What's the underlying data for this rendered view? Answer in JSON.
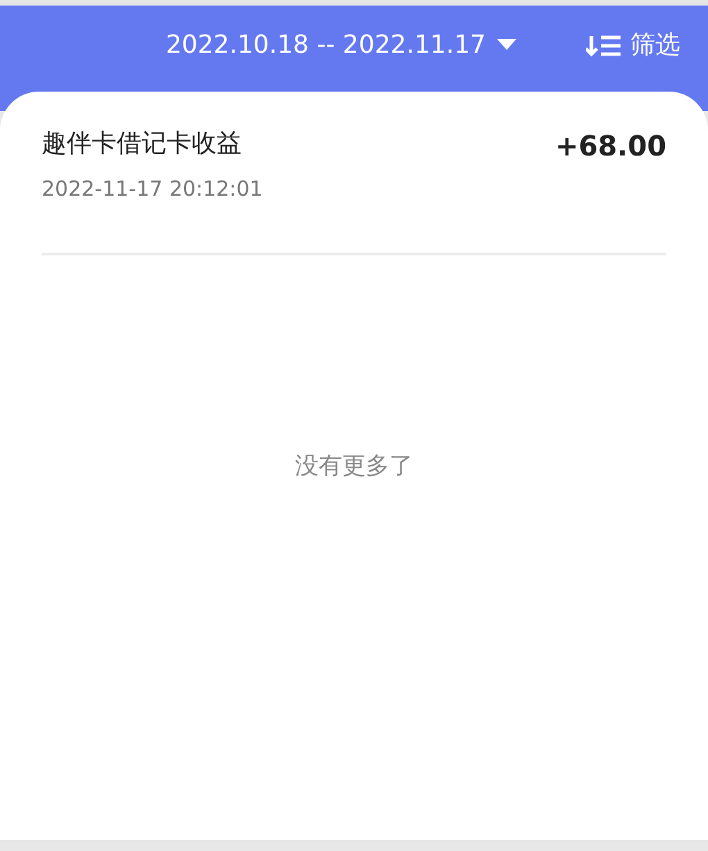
{
  "header": {
    "date_range": "2022.10.18 -- 2022.11.17",
    "filter_label": "筛选"
  },
  "records": [
    {
      "title": "趣伴卡借记卡收益",
      "amount": "+68.00",
      "time": "2022-11-17 20:12:01"
    }
  ],
  "footer_note": "没有更多了"
}
